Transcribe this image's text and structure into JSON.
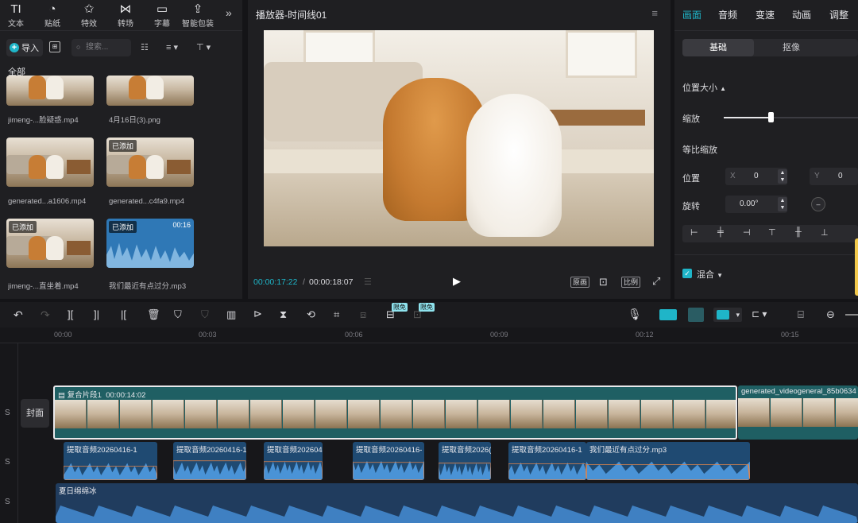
{
  "toolbar": {
    "items": [
      {
        "label": "文本",
        "icon": "text-icon"
      },
      {
        "label": "贴纸",
        "icon": "sticker-icon"
      },
      {
        "label": "特效",
        "icon": "effects-icon"
      },
      {
        "label": "转场",
        "icon": "transition-icon"
      },
      {
        "label": "字幕",
        "icon": "subtitle-icon"
      },
      {
        "label": "智能包装",
        "icon": "smart-pack-icon"
      }
    ],
    "more": "»"
  },
  "media": {
    "import_label": "导入",
    "search_placeholder": "搜索...",
    "all_label": "全部",
    "items": [
      {
        "caption": "jimeng-...脸疑惑.mp4",
        "badge": ""
      },
      {
        "caption": "4月16日(3).png",
        "badge": ""
      },
      {
        "caption": "generated...a1606.mp4",
        "badge": ""
      },
      {
        "caption": "generated...c4fa9.mp4",
        "badge": "已添加"
      },
      {
        "caption": "jimeng-...直坐着.mp4",
        "badge": "已添加"
      },
      {
        "caption": "我们最近有点过分.mp3",
        "badge": "已添加",
        "duration": "00:16"
      }
    ]
  },
  "player": {
    "title": "播放器-时间线01",
    "current_time": "00:00:17:22",
    "total_time": "00:00:18:07",
    "btn_original": "原画",
    "btn_ratio": "比例"
  },
  "props": {
    "tabs": [
      "画面",
      "音频",
      "变速",
      "动画",
      "调整"
    ],
    "active_tab": "画面",
    "seg_on": "基础",
    "seg_off": "抠像",
    "section_position_size": "位置大小",
    "scale_label": "缩放",
    "scale_level": 0.35,
    "uniform_scale_label": "等比缩放",
    "position_label": "位置",
    "pos_x_label": "X",
    "pos_x": "0",
    "pos_y_label": "Y",
    "pos_y": "0",
    "rotate_label": "旋转",
    "rotate_value": "0.00°",
    "blend_label": "混合",
    "accent": "#1fb5c8"
  },
  "timeline": {
    "ticks": [
      "00:00",
      "00:03",
      "00:06",
      "00:09",
      "00:12",
      "00:15"
    ],
    "badge_free_1": "限免",
    "badge_free_2": "限免",
    "cover_label": "封面",
    "track_s": "S",
    "compound_clip_label": "复合片段1",
    "compound_clip_duration": "00:00:14:02",
    "video_clip_2": "generated_videogeneral_85b0634",
    "audio_clips": [
      "提取音频20260416-1",
      "提取音频20260416-1",
      "提取音频202604",
      "提取音频20260416-",
      "提取音频2026(",
      "提取音频20260416-1",
      "我们最近有点过分.mp3"
    ],
    "music_clip": "夏日绵绵冰"
  }
}
